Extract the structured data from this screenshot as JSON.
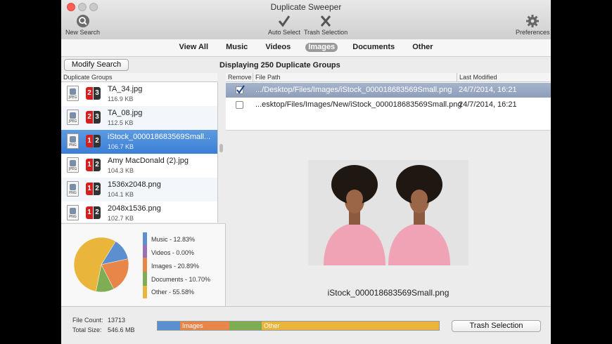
{
  "window": {
    "title": "Duplicate Sweeper"
  },
  "toolbar": {
    "new_search": "New Search",
    "auto_select": "Auto Select",
    "trash_selection": "Trash Selection",
    "preferences": "Preferences"
  },
  "tabs": [
    "View All",
    "Music",
    "Videos",
    "Images",
    "Documents",
    "Other"
  ],
  "active_tab": "Images",
  "modify_search": "Modify Search",
  "header_title": "Displaying 250 Duplicate Groups",
  "left_columns": {
    "groups": "Duplicate Groups"
  },
  "right_columns": {
    "remove": "Remove",
    "path": "File Path",
    "modified": "Last Modified"
  },
  "groups": [
    {
      "name": "TA_34.jpg",
      "size": "116.9 KB",
      "type": "JPEG",
      "a": "2",
      "b": "3"
    },
    {
      "name": "TA_08.jpg",
      "size": "112.5 KB",
      "type": "JPEG",
      "a": "2",
      "b": "3"
    },
    {
      "name": "iStock_000018683569Small...",
      "size": "106.7 KB",
      "type": "PNG",
      "a": "1",
      "b": "2"
    },
    {
      "name": "Amy MacDonald (2).jpg",
      "size": "104.3 KB",
      "type": "JPEG",
      "a": "1",
      "b": "2"
    },
    {
      "name": "1536x2048.png",
      "size": "104.1 KB",
      "type": "PNG",
      "a": "1",
      "b": "2"
    },
    {
      "name": "2048x1536.png",
      "size": "102.7 KB",
      "type": "PNG",
      "a": "1",
      "b": "2"
    }
  ],
  "files": [
    {
      "path": ".../Desktop/Files/Images/iStock_000018683569Small.png",
      "modified": "24/7/2014, 16:21",
      "checked": true
    },
    {
      "path": "...esktop/Files/Images/New/iStock_000018683569Small.png",
      "modified": "24/7/2014, 16:21",
      "checked": false
    }
  ],
  "preview_caption": "iStock_000018683569Small.png",
  "legend": [
    {
      "label": "Music - 12.83%",
      "value": 12.83,
      "color": "#5b8fcf"
    },
    {
      "label": "Videos - 0.00%",
      "value": 0.0,
      "color": "#9a6fb5"
    },
    {
      "label": "Images - 20.89%",
      "value": 20.89,
      "color": "#e8864a"
    },
    {
      "label": "Documents - 10.70%",
      "value": 10.7,
      "color": "#7fad53"
    },
    {
      "label": "Other - 55.58%",
      "value": 55.58,
      "color": "#e9b53b"
    }
  ],
  "stats": {
    "file_count_label": "File Count:",
    "file_count": "13713",
    "total_size_label": "Total Size:",
    "total_size": "546.6 MB"
  },
  "usage_bar": [
    {
      "label": "",
      "fraction": 0.08,
      "color": "#5b8fcf"
    },
    {
      "label": "Images",
      "fraction": 0.175,
      "color": "#e8864a"
    },
    {
      "label": "",
      "fraction": 0.115,
      "color": "#7fad53"
    },
    {
      "label": "Other",
      "fraction": 0.63,
      "color": "#e9b53b"
    }
  ],
  "trash_button": "Trash Selection"
}
